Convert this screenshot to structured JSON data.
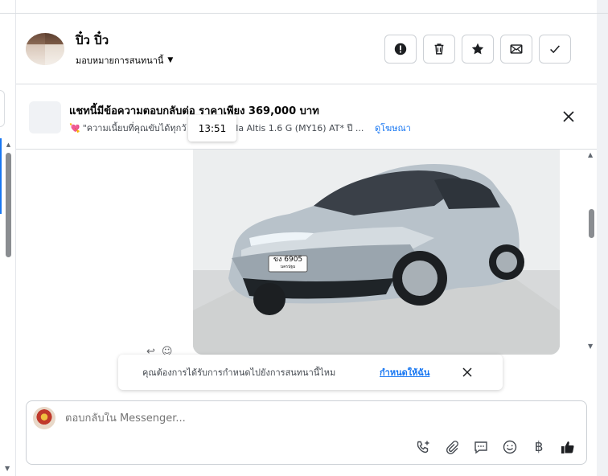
{
  "header": {
    "contact_name": "ปิ๋ว ปิ๋ว",
    "assign_label": "มอบหมายการสนทนานี้",
    "actions": [
      {
        "name": "spam-button",
        "icon": "alert-circle-icon"
      },
      {
        "name": "delete-button",
        "icon": "trash-icon"
      },
      {
        "name": "star-button",
        "icon": "star-icon"
      },
      {
        "name": "mark-unread-button",
        "icon": "envelope-icon"
      },
      {
        "name": "mark-done-button",
        "icon": "check-icon"
      }
    ]
  },
  "ad": {
    "title": "แชทนี้มีข้อความตอบกลับต่อ ราคาเพียง 369,000 บาท",
    "description_start": "\"ความเนี้ยบที่คุณขับได้ทุกวั",
    "description_end": "olla Altis 1.6 G (MY16) AT* ปี ...",
    "link": "ดูโฆษณา",
    "time_tooltip": "13:51"
  },
  "car": {
    "plate": "ขง 6905",
    "plate_sub": "นครปฐม"
  },
  "notice": {
    "text": "คุณต้องการได้รับการกำหนดไปยังการสนทนานี้ไหม",
    "link": "กำหนดให้ฉัน"
  },
  "composer": {
    "placeholder": "ตอบกลับใน Messenger...",
    "currency_symbol": "฿"
  },
  "colors": {
    "accent": "#1877f2",
    "border": "#ccd0d5",
    "text": "#050505"
  }
}
